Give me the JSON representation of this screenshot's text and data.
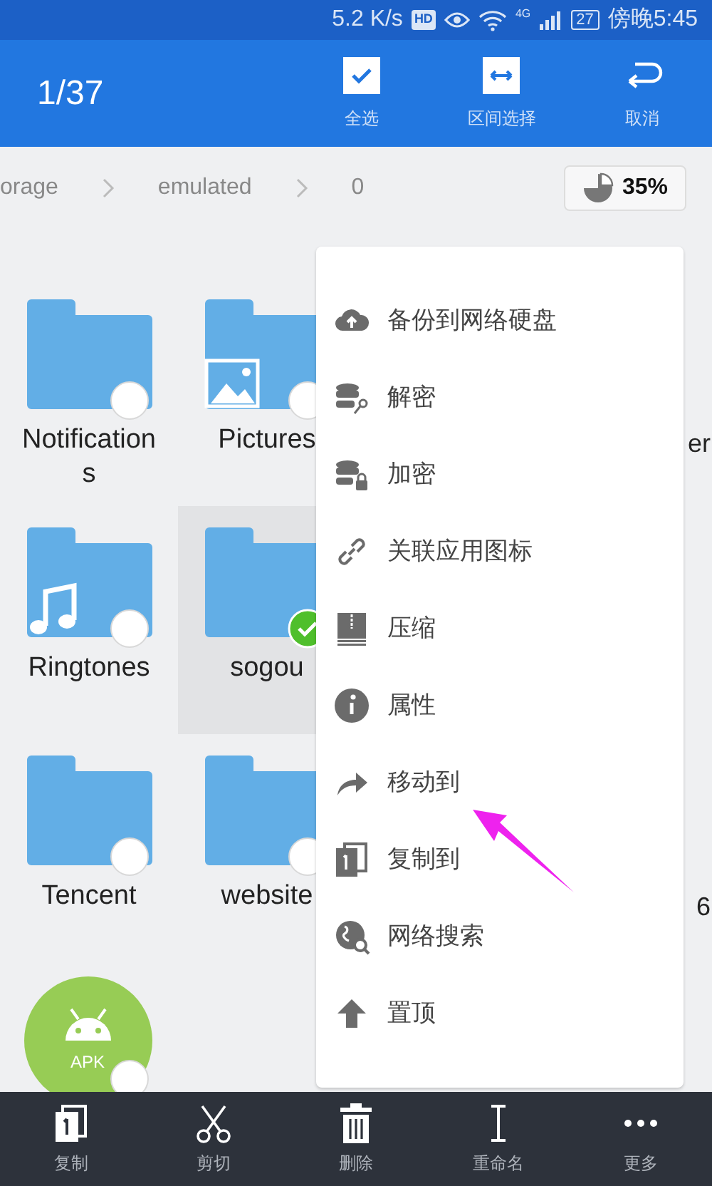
{
  "status_bar": {
    "net_speed": "5.2 K/s",
    "hd_badge": "HD",
    "network": "4G",
    "battery": "27",
    "time": "傍晚5:45"
  },
  "header": {
    "count": "1/37",
    "actions": [
      {
        "label": "全选",
        "kind": "check"
      },
      {
        "label": "区间选择",
        "kind": "range"
      },
      {
        "label": "取消",
        "kind": "cancel"
      }
    ]
  },
  "breadcrumb": {
    "segments": [
      "orage",
      "emulated",
      "0"
    ],
    "storage_usage": "35%"
  },
  "files": [
    {
      "name": "Notifications",
      "kind": "folder",
      "selected": false
    },
    {
      "name": "Pictures",
      "kind": "pictures",
      "selected": false
    },
    {
      "name": "Ringtones",
      "kind": "music",
      "selected": false
    },
    {
      "name": "sogou",
      "kind": "folder",
      "selected": true
    },
    {
      "name": "Tencent",
      "kind": "folder",
      "selected": false
    },
    {
      "name": "website",
      "kind": "folder",
      "selected": false
    },
    {
      "name": "APK",
      "kind": "apk",
      "selected": false
    }
  ],
  "right_column_labels": [
    "er",
    "6"
  ],
  "context_menu": [
    {
      "label": "备份到网络硬盘",
      "kind": "cloud"
    },
    {
      "label": "解密",
      "kind": "decrypt"
    },
    {
      "label": "加密",
      "kind": "encrypt"
    },
    {
      "label": "关联应用图标",
      "kind": "link"
    },
    {
      "label": "压缩",
      "kind": "zip"
    },
    {
      "label": "属性",
      "kind": "info"
    },
    {
      "label": "移动到",
      "kind": "move"
    },
    {
      "label": "复制到",
      "kind": "copyto"
    },
    {
      "label": "网络搜索",
      "kind": "search"
    },
    {
      "label": "置顶",
      "kind": "top"
    }
  ],
  "toolbar": [
    {
      "label": "复制",
      "kind": "copy"
    },
    {
      "label": "剪切",
      "kind": "cut"
    },
    {
      "label": "删除",
      "kind": "delete"
    },
    {
      "label": "重命名",
      "kind": "rename"
    },
    {
      "label": "更多",
      "kind": "more"
    }
  ]
}
